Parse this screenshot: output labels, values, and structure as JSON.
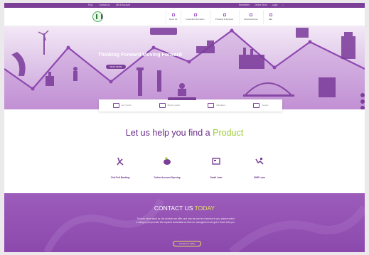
{
  "topbar": {
    "left_links": [
      "FAQ",
      "Contact us",
      "Bill & Account"
    ],
    "right_links": [
      "Newsletter",
      "Online Store",
      "Login"
    ],
    "search_icon": "search-icon"
  },
  "navbar": {
    "logo_icon": "bank-logo-icon",
    "items": [
      {
        "label": "About Us",
        "icon": "info-icon"
      },
      {
        "label": "Financial Information",
        "icon": "report-icon"
      },
      {
        "label": "Products & Services",
        "icon": "briefcase-icon"
      },
      {
        "label": "Financial Home",
        "icon": "home-icon"
      },
      {
        "label": "HEL",
        "icon": "help-icon"
      }
    ]
  },
  "hero": {
    "title": "Thinking Forward Moving Forward",
    "button_label": "READ MORE",
    "slide_count": 5
  },
  "quick_links": [
    {
      "label": "Get in touch",
      "icon": "phone-icon"
    },
    {
      "label": "Branch Locator",
      "icon": "map-icon"
    },
    {
      "label": "Calculators",
      "icon": "calculator-icon"
    },
    {
      "label": "Careers",
      "icon": "people-icon"
    }
  ],
  "help": {
    "title_prefix": "Let us help you find a ",
    "title_highlight": "Product"
  },
  "products": [
    {
      "label": "Civil Felt Banking",
      "icon": "hand-icon"
    },
    {
      "label": "Online Account Opening",
      "icon": "piggy-bank-icon"
    },
    {
      "label": "Small Loan",
      "icon": "loan-icon"
    },
    {
      "label": "SME Loan",
      "icon": "handshake-icon"
    }
  ],
  "contact": {
    "title_prefix": "CONTACT US ",
    "title_highlight": "TODAY",
    "body": "To know more about us, the services we offer, and how we can be of service to you, please select a category and provide the required credentials so that our management can get in touch with you.",
    "button_label": "Contact Us Today"
  },
  "colors": {
    "primary": "#7b3f98",
    "accent_green": "#9acd32",
    "accent_yellow": "#e6e05a"
  }
}
